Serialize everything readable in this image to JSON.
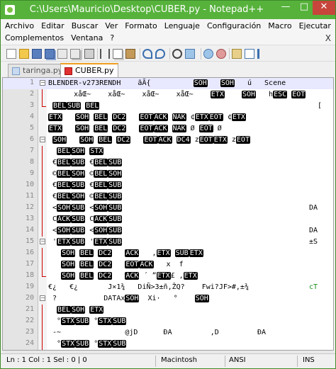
{
  "window": {
    "title": "C:\\Users\\Mauricio\\Desktop\\CUBER.py - Notepad++",
    "controls": {
      "minimize": "—",
      "maximize": "□",
      "close": "✕"
    }
  },
  "menu": {
    "row1": [
      "Archivo",
      "Editar",
      "Buscar",
      "Ver",
      "Formato",
      "Lenguaje",
      "Configuración",
      "Macro",
      "Ejecutar"
    ],
    "row2": [
      "Complementos",
      "Ventana",
      "?"
    ],
    "close_doc": "X"
  },
  "toolbar": {
    "icons": [
      "new-file-icon",
      "open-file-icon",
      "save-icon",
      "save-all-icon",
      "close-icon",
      "close-all-icon",
      "print-icon",
      "cut-icon",
      "copy-icon",
      "paste-icon",
      "undo-icon",
      "redo-icon",
      "find-icon",
      "replace-icon",
      "zoom-in-icon",
      "zoom-out-icon",
      "sync-scroll-icon",
      "word-wrap-icon",
      "show-all-chars-icon"
    ]
  },
  "tabs": [
    {
      "label": "taringa.py",
      "active": false
    },
    {
      "label": "CUBER.py",
      "active": true
    }
  ],
  "editor": {
    "lines": [
      {
        "n": "1",
        "code": "BLENDER-v273RENDH    ãÃ{          SOH   SOH   ú   Scene",
        "fold": "box",
        "current": true
      },
      {
        "n": "2",
        "code": "      xåŒ~    xåŒ~    xåŒ~    xåŒ~    ETX    SOH   hESC EOT",
        "fold": "line"
      },
      {
        "n": "3",
        "code": " BELSUB BEL",
        "fold": "end",
        "right": "["
      },
      {
        "n": "4",
        "code": "ETX   SOH BEL DC2   EOTACK NAK ¢ETXEOT ¢ETX",
        "fold": ""
      },
      {
        "n": "5",
        "code": "ETX   SOH BEL DC2   EOTACK NAK Ø EOT Ø",
        "fold": ""
      },
      {
        "n": "6",
        "code": " SOH   SOH BEL DC2   EOTACK DC4 zEOTETX zEOT",
        "fold": "box"
      },
      {
        "n": "7",
        "code": "  BELSOH STX",
        "fold": "line"
      },
      {
        "n": "8",
        "code": " €BELSUB €BELSUB",
        "fold": "line"
      },
      {
        "n": "9",
        "code": " ©BELSOH ©BELSOH",
        "fold": "line"
      },
      {
        "n": "10",
        "code": " €BELSUB €BELSUB",
        "fold": "line"
      },
      {
        "n": "11",
        "code": " €BELSOH ©BELSUB",
        "fold": "line"
      },
      {
        "n": "12",
        "code": " <SOHSUB <SOHSUB",
        "fold": "line",
        "right": "DA"
      },
      {
        "n": "13",
        "code": " CACKSUB CACKSUB",
        "fold": "line"
      },
      {
        "n": "14",
        "code": " <SOHSUB <SOHSUB",
        "fold": "line",
        "right": "DA"
      },
      {
        "n": "15",
        "code": " 'ETXSUB 'ETXSUB",
        "fold": "box",
        "right": "±S"
      },
      {
        "n": "16",
        "code": "   SOH BEL DC2   ACK   ,ETX SUBETX",
        "fold": "line"
      },
      {
        "n": "17",
        "code": "   SOH BEL DC2   EOTACK   x  f",
        "fold": "line"
      },
      {
        "n": "18",
        "code": "   SOH BEL DC2   ACK ´ ”ETX£ ,ETX",
        "fold": "end"
      },
      {
        "n": "19",
        "code": "€¿   €¿       J×1¾   DiÑ>3±ñ,ŽQ?    Fwi?JF>#,±¾",
        "fold": "",
        "right": "cT"
      },
      {
        "n": "20",
        "code": " ?           DATAxSOH  Xi·   °    SOH",
        "fold": "box"
      },
      {
        "n": "21",
        "code": "  BELSOH ETX",
        "fold": "line"
      },
      {
        "n": "22",
        "code": "  °STXSUB °STXSUB",
        "fold": "line"
      },
      {
        "n": "23",
        "code": " -~               @jD      ĐA         ,D         ĐA",
        "fold": "line"
      },
      {
        "n": "24",
        "code": "  °STXSUB °STXSUB",
        "fold": "line"
      }
    ]
  },
  "status": {
    "position": "Ln : 1    Col : 1    Sel : 0 | 0",
    "eol": "Macintosh",
    "encoding": "ANSI",
    "mode": "INS"
  },
  "colors": {
    "titlebar": "#56b23b",
    "close_button": "#c7453b",
    "control_char_bg": "#000000",
    "active_tab_accent": "#f0a020"
  }
}
